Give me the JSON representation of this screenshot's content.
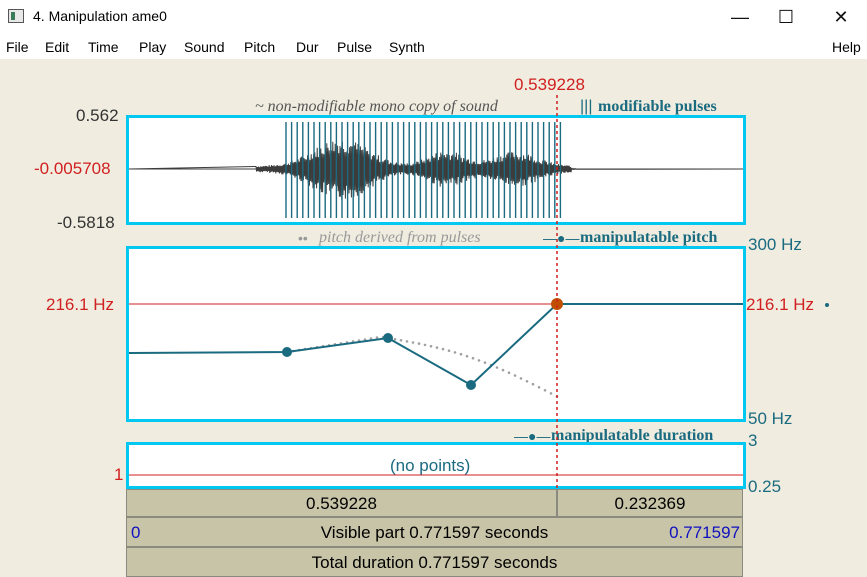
{
  "window": {
    "title": "4. Manipulation ame0",
    "minimize_glyph": "—",
    "maximize_glyph": "☐",
    "close_glyph": "✕"
  },
  "menu": {
    "items": [
      "File",
      "Edit",
      "Time",
      "Play",
      "Sound",
      "Pitch",
      "Dur",
      "Pulse",
      "Synth"
    ],
    "help": "Help"
  },
  "cursor": {
    "time_label": "0.539228"
  },
  "sound_panel": {
    "caption_sound": "~ non-modifiable mono copy of sound",
    "caption_pulses_mark": "|||",
    "caption_pulses": "modifiable pulses",
    "y_max": "0.562",
    "y_cursor": "-0.005708",
    "y_min": "-0.5818"
  },
  "pitch_panel": {
    "caption_derived_mark": "••",
    "caption_derived": "pitch derived from pulses",
    "caption_manip_mark": "—●—",
    "caption_manip": "manipulatable pitch",
    "y_top": "300 Hz",
    "y_bottom": "50 Hz",
    "cursor_left": "216.1 Hz",
    "cursor_right": "216.1 Hz"
  },
  "duration_panel": {
    "caption_mark": "—●—",
    "caption": "manipulatable duration",
    "y_top": "3",
    "y_bottom": "0.25",
    "y_cursor": "1",
    "no_points": "(no points)"
  },
  "time_bar": {
    "left_segment": "0.539228",
    "right_segment": "0.232369"
  },
  "visible_bar": {
    "start": "0",
    "text": "Visible part 0.771597 seconds",
    "end": "0.771597"
  },
  "total_bar": {
    "text": "Total duration 0.771597 seconds"
  },
  "colors": {
    "frame": "#00c8f0",
    "teal": "#1a6a80",
    "cursor_red": "#d02020",
    "waveform": "#3c3c3c",
    "pitch_point_selected": "#c05000",
    "blue_text": "#1010c0"
  }
}
